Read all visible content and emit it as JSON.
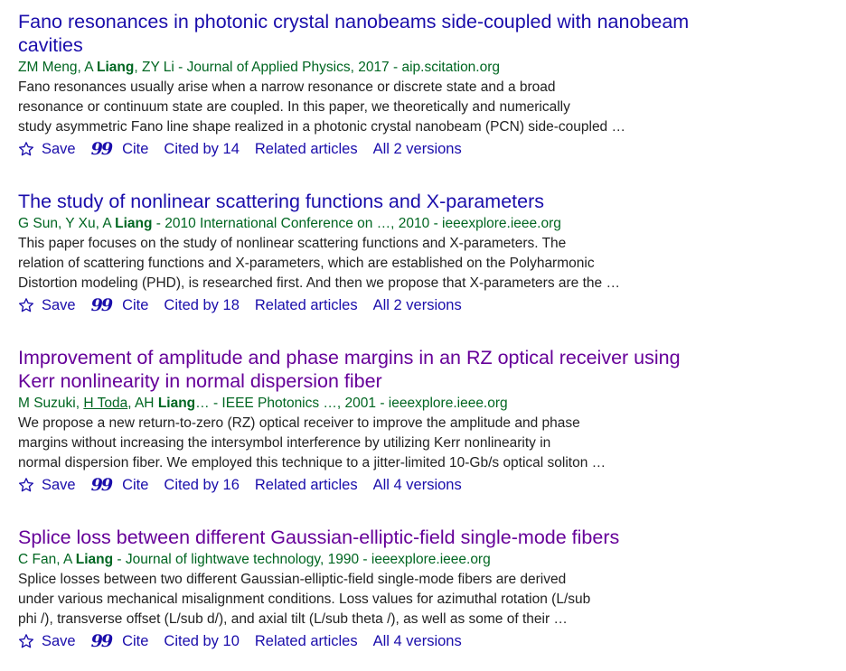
{
  "actions": {
    "save": "Save",
    "cite": "Cite",
    "related": "Related articles"
  },
  "results": [
    {
      "title_lines": [
        "Fano resonances in photonic crystal nanobeams side-coupled with nanobeam",
        "cavities"
      ],
      "authors_pre": "ZM Meng, A ",
      "author_bold": "Liang",
      "authors_post": ", ZY Li",
      "source": " - Journal of Applied Physics, 2017 - aip.scitation.org",
      "snippet": [
        "Fano resonances usually arise when a narrow resonance or discrete state and a broad",
        "resonance or continuum state are coupled. In this paper, we theoretically and numerically",
        "study asymmetric Fano line shape realized in a photonic crystal nanobeam (PCN) side-coupled …"
      ],
      "cited_by": "Cited by 14",
      "versions": "All 2 versions"
    },
    {
      "title_lines": [
        "The study of nonlinear scattering functions and X-parameters"
      ],
      "authors_pre": "G Sun, Y Xu, A ",
      "author_bold": "Liang",
      "authors_post": "",
      "source": " - 2010 International Conference on …, 2010 - ieeexplore.ieee.org",
      "snippet": [
        "This paper focuses on the study of nonlinear scattering functions and X-parameters. The",
        "relation of scattering functions and X-parameters, which are established on the Polyharmonic",
        "Distortion modeling (PHD), is researched first. And then we propose that X-parameters are the …"
      ],
      "cited_by": "Cited by 18",
      "versions": "All 2 versions"
    },
    {
      "title_lines": [
        "Improvement of amplitude and phase margins in an RZ optical receiver using",
        "Kerr nonlinearity in normal dispersion fiber"
      ],
      "authors_pre": "M Suzuki, ",
      "author_link": "H Toda",
      "authors_mid": ", AH ",
      "author_bold": "Liang",
      "authors_post": "…",
      "source": " - IEEE Photonics …, 2001 - ieeexplore.ieee.org",
      "snippet": [
        "We propose a new return-to-zero (RZ) optical receiver to improve the amplitude and phase",
        "margins without increasing the intersymbol interference by utilizing Kerr nonlinearity in",
        "normal dispersion fiber. We employed this technique to a jitter-limited 10-Gb/s optical soliton …"
      ],
      "cited_by": "Cited by 16",
      "versions": "All 4 versions"
    },
    {
      "title_lines": [
        "Splice loss between different Gaussian-elliptic-field single-mode fibers"
      ],
      "authors_pre": "C Fan, A ",
      "author_bold": "Liang",
      "authors_post": "",
      "source": " - Journal of lightwave technology, 1990 - ieeexplore.ieee.org",
      "snippet": [
        "Splice losses between two different Gaussian-elliptic-field single-mode fibers are derived",
        "under various mechanical misalignment conditions. Loss values for azimuthal rotation (L/sub",
        "phi /), transverse offset (L/sub d/), and axial tilt (L/sub theta /), as well as some of their …"
      ],
      "cited_by": "Cited by 10",
      "versions": "All 4 versions"
    }
  ]
}
